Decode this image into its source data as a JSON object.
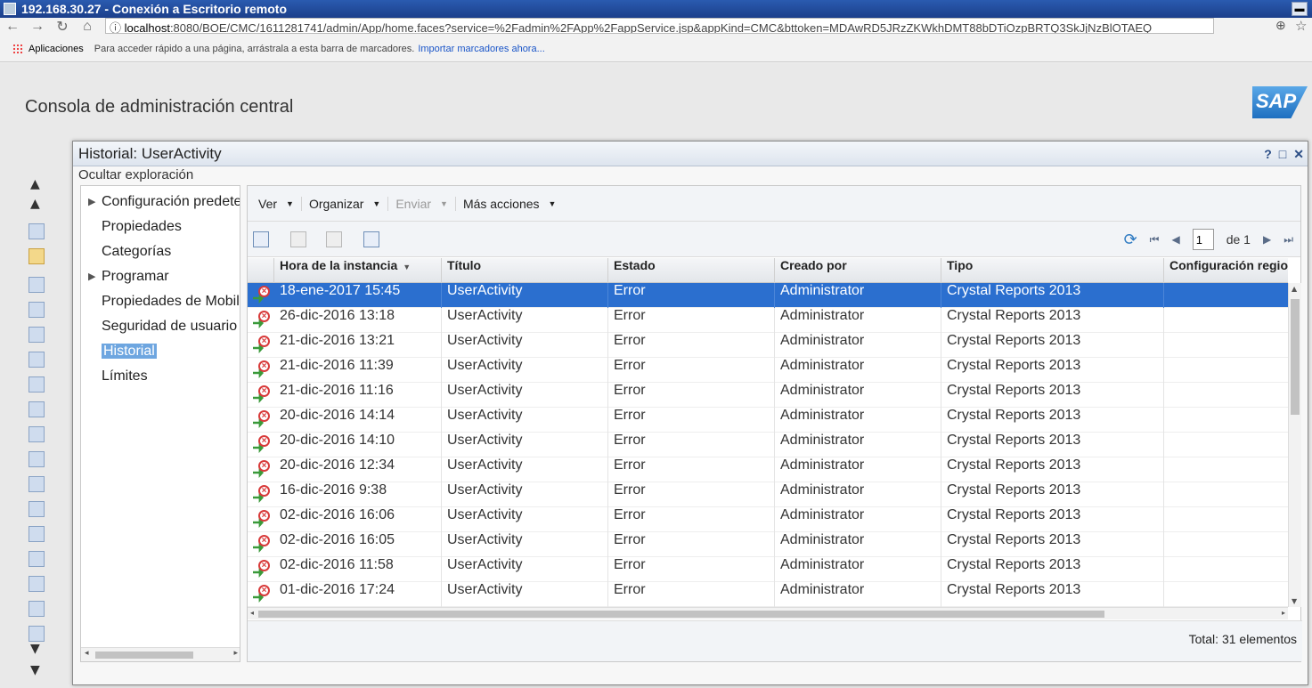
{
  "rdp": {
    "title": "192.168.30.27 - Conexión a Escritorio remoto"
  },
  "browser": {
    "url_host": "localhost",
    "url_rest": ":8080/BOE/CMC/1611281741/admin/App/home.faces?service=%2Fadmin%2FApp%2FappService.jsp&appKind=CMC&bttoken=MDAwRD5JRzZKWkhDMT88bDTiOzpBRTQ3SkJjNzBlOTAEQ",
    "bookmarks_apps": "Aplicaciones",
    "bookmarks_hint": "Para acceder rápido a una página, arrástrala a esta barra de marcadores.",
    "bookmarks_import": "Importar marcadores ahora..."
  },
  "cmc": {
    "title": "Consola de administración central",
    "logo": "SAP"
  },
  "dialog": {
    "title": "Historial: UserActivity",
    "help": "?",
    "maximize": "□",
    "close": "✕",
    "hide_explore": "Ocultar exploración"
  },
  "nav": [
    {
      "label": "Configuración predeterminada",
      "expandable": true
    },
    {
      "label": "Propiedades",
      "expandable": false
    },
    {
      "label": "Categorías",
      "expandable": false
    },
    {
      "label": "Programar",
      "expandable": true
    },
    {
      "label": "Propiedades de Mobile",
      "expandable": false
    },
    {
      "label": "Seguridad de usuario",
      "expandable": false
    },
    {
      "label": "Historial",
      "expandable": false,
      "active": true
    },
    {
      "label": "Límites",
      "expandable": false
    }
  ],
  "toolbar": {
    "view": "Ver",
    "organize": "Organizar",
    "send": "Enviar",
    "more": "Más acciones"
  },
  "pager": {
    "page": "1",
    "of": "de 1"
  },
  "grid": {
    "columns": [
      "Hora de la instancia",
      "Título",
      "Estado",
      "Creado por",
      "Tipo",
      "Configuración regional"
    ],
    "rows": [
      [
        "18-ene-2017 15:45",
        "UserActivity",
        "Error",
        "Administrator",
        "Crystal Reports 2013"
      ],
      [
        "26-dic-2016 13:18",
        "UserActivity",
        "Error",
        "Administrator",
        "Crystal Reports 2013"
      ],
      [
        "21-dic-2016 13:21",
        "UserActivity",
        "Error",
        "Administrator",
        "Crystal Reports 2013"
      ],
      [
        "21-dic-2016 11:39",
        "UserActivity",
        "Error",
        "Administrator",
        "Crystal Reports 2013"
      ],
      [
        "21-dic-2016 11:16",
        "UserActivity",
        "Error",
        "Administrator",
        "Crystal Reports 2013"
      ],
      [
        "20-dic-2016 14:14",
        "UserActivity",
        "Error",
        "Administrator",
        "Crystal Reports 2013"
      ],
      [
        "20-dic-2016 14:10",
        "UserActivity",
        "Error",
        "Administrator",
        "Crystal Reports 2013"
      ],
      [
        "20-dic-2016 12:34",
        "UserActivity",
        "Error",
        "Administrator",
        "Crystal Reports 2013"
      ],
      [
        "16-dic-2016 9:38",
        "UserActivity",
        "Error",
        "Administrator",
        "Crystal Reports 2013"
      ],
      [
        "02-dic-2016 16:06",
        "UserActivity",
        "Error",
        "Administrator",
        "Crystal Reports 2013"
      ],
      [
        "02-dic-2016 16:05",
        "UserActivity",
        "Error",
        "Administrator",
        "Crystal Reports 2013"
      ],
      [
        "02-dic-2016 11:58",
        "UserActivity",
        "Error",
        "Administrator",
        "Crystal Reports 2013"
      ],
      [
        "01-dic-2016 17:24",
        "UserActivity",
        "Error",
        "Administrator",
        "Crystal Reports 2013"
      ]
    ],
    "selected_index": 0
  },
  "footer": {
    "total": "Total: 31 elementos"
  },
  "colors": {
    "selection": "#2b6fcf",
    "nav_active": "#6ea6e0",
    "error": "#d83a3a",
    "success_arrow": "#3a9a3a"
  }
}
